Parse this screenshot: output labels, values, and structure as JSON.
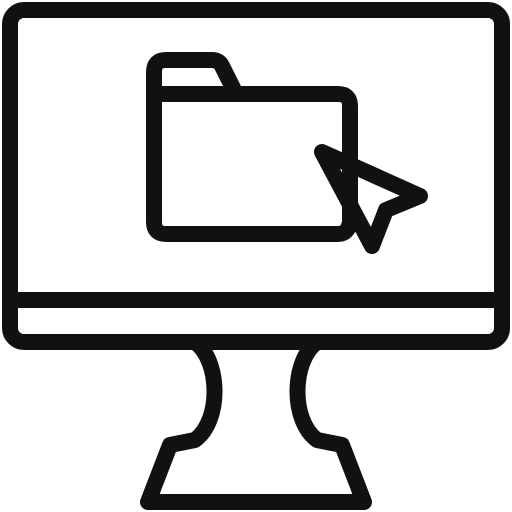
{
  "icon": {
    "name": "computer-folder-cursor-icon",
    "parts": [
      "monitor-icon",
      "folder-icon",
      "cursor-arrow-icon",
      "monitor-stand-icon"
    ]
  },
  "colors": {
    "stroke": "#111111",
    "background": "#ffffff"
  }
}
